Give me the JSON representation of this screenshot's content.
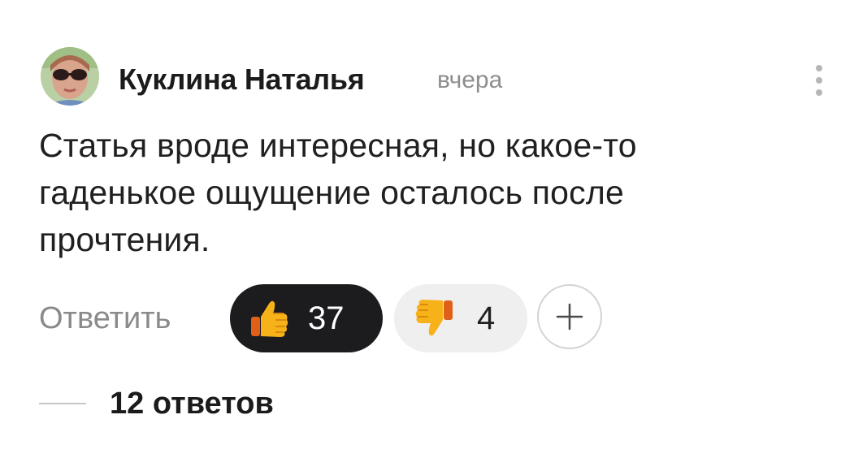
{
  "comment": {
    "author": "Куклина Наталья",
    "timestamp": "вчера",
    "avatar_icon": "user-avatar-photo",
    "text": "Статья вроде интересная, но какое-то гаденькое ощущение осталось после прочтения.",
    "more_icon": "vertical-dots-icon"
  },
  "actions": {
    "reply_label": "Ответить",
    "like": {
      "icon": "thumbs-up-emoji",
      "count": "37",
      "background": "#1c1c1e"
    },
    "dislike": {
      "icon": "thumbs-down-emoji",
      "count": "4",
      "background": "#efefef"
    },
    "add_reaction_icon": "plus-icon"
  },
  "replies": {
    "label": "12 ответов"
  }
}
